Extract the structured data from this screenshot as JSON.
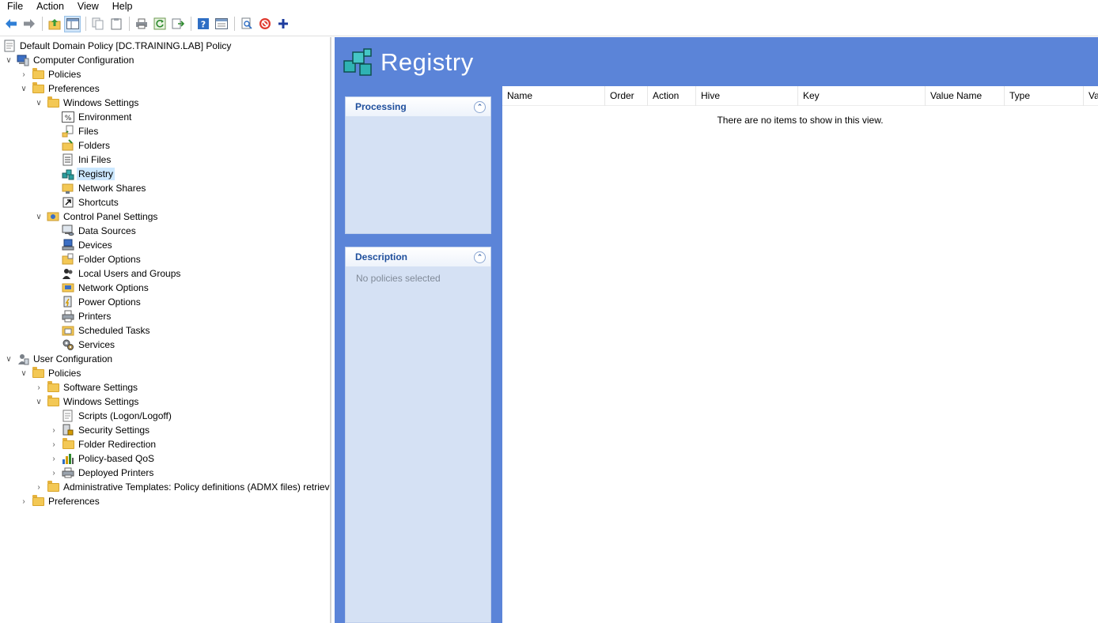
{
  "menu": [
    "File",
    "Action",
    "View",
    "Help"
  ],
  "toolbar": {
    "icons": [
      "back-arrow-icon",
      "forward-arrow-icon",
      "up-folder-icon",
      "show-hide-tree-icon",
      "copy-icon",
      "paste-icon",
      "print-icon",
      "refresh-icon",
      "export-list-icon",
      "help-icon",
      "properties-icon",
      "find-icon",
      "stop-icon",
      "add-icon"
    ]
  },
  "tree": {
    "root": "Default Domain Policy [DC.TRAINING.LAB] Policy",
    "computer_config": "Computer Configuration",
    "cc_policies": "Policies",
    "cc_preferences": "Preferences",
    "cc_windows_settings": "Windows Settings",
    "environment": "Environment",
    "files": "Files",
    "folders": "Folders",
    "ini_files": "Ini Files",
    "registry": "Registry",
    "network_shares": "Network Shares",
    "shortcuts": "Shortcuts",
    "control_panel_settings": "Control Panel Settings",
    "data_sources": "Data Sources",
    "devices": "Devices",
    "folder_options": "Folder Options",
    "local_users_groups": "Local Users and Groups",
    "network_options": "Network Options",
    "power_options": "Power Options",
    "printers": "Printers",
    "scheduled_tasks": "Scheduled Tasks",
    "services": "Services",
    "user_config": "User Configuration",
    "uc_policies": "Policies",
    "software_settings": "Software Settings",
    "uc_windows_settings": "Windows Settings",
    "scripts": "Scripts (Logon/Logoff)",
    "security_settings": "Security Settings",
    "folder_redirection": "Folder Redirection",
    "policy_qos": "Policy-based QoS",
    "deployed_printers": "Deployed Printers",
    "admin_templates": "Administrative Templates: Policy definitions (ADMX files) retriev",
    "uc_preferences": "Preferences"
  },
  "main": {
    "title": "Registry",
    "processing_label": "Processing",
    "description_label": "Description",
    "description_text": "No policies selected",
    "columns": [
      "Name",
      "Order",
      "Action",
      "Hive",
      "Key",
      "Value Name",
      "Type",
      "Va"
    ],
    "empty_message": "There are no items to show in this view."
  },
  "colors": {
    "header_blue": "#5b84d8",
    "panel_blue": "#d5e1f4",
    "selection": "#cce8ff"
  }
}
